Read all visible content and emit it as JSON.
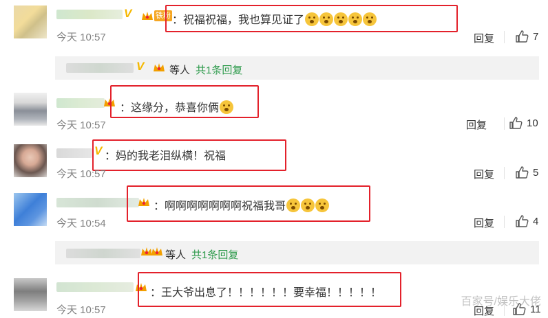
{
  "comments": [
    {
      "text": "：祝福祝福，我也算见证了",
      "emoji_count": 5,
      "time": "今天 10:57",
      "reply": "回复",
      "likes": "7"
    },
    {
      "text": "：这缘分，恭喜你俩",
      "emoji_count": 1,
      "time": "今天 10:57",
      "reply": "回复",
      "likes": "10"
    },
    {
      "text": "：妈的我老泪纵横！祝福",
      "emoji_count": 0,
      "time": "今天 10:57",
      "reply": "回复",
      "likes": "5"
    },
    {
      "text": "：啊啊啊啊啊啊啊祝福我哥",
      "emoji_count": 3,
      "time": "今天 10:54",
      "reply": "回复",
      "likes": "4"
    },
    {
      "text": "：王大爷出息了！！！！！！要幸福！！！！！",
      "emoji_count": 0,
      "time": "今天 10:57",
      "reply": "回复",
      "likes": "11"
    }
  ],
  "sub_replies": [
    {
      "others": "等人",
      "count_text": "共1条回复"
    },
    {
      "others": "等人",
      "count_text": "共1条回复"
    }
  ],
  "badge_v": "V",
  "badge_fans": "铁粉",
  "watermark": "百家号/娱乐大佬",
  "colors": {
    "highlight": "#e3212b",
    "reply_link": "#2d9a4b",
    "badge": "#f5b800"
  }
}
